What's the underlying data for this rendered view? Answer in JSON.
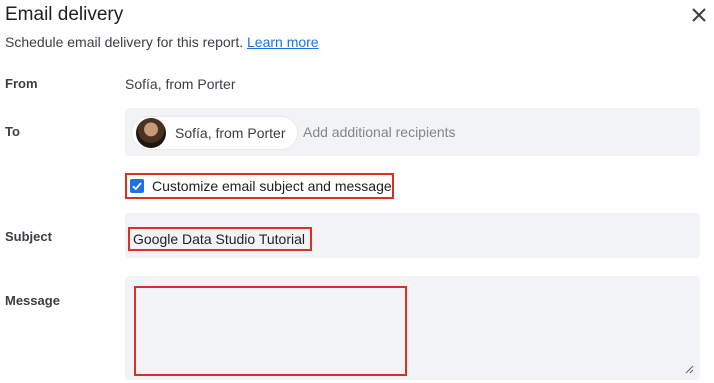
{
  "dialog": {
    "title": "Email delivery",
    "close_icon": "close-icon",
    "subtitle": "Schedule email delivery for this report.",
    "learn_more": "Learn more"
  },
  "from": {
    "label": "From",
    "value": "Sofía, from Porter"
  },
  "to": {
    "label": "To",
    "chip_name": "Sofía, from Porter",
    "recipients_placeholder": "Add additional recipients"
  },
  "customize": {
    "checked": true,
    "label": "Customize email subject and message"
  },
  "subject": {
    "label": "Subject",
    "value": "Google Data Studio Tutorial"
  },
  "message": {
    "label": "Message",
    "value": ""
  },
  "colors": {
    "accent": "#1a73e8",
    "highlight": "#d93025",
    "field_bg": "#f1f3f4"
  }
}
